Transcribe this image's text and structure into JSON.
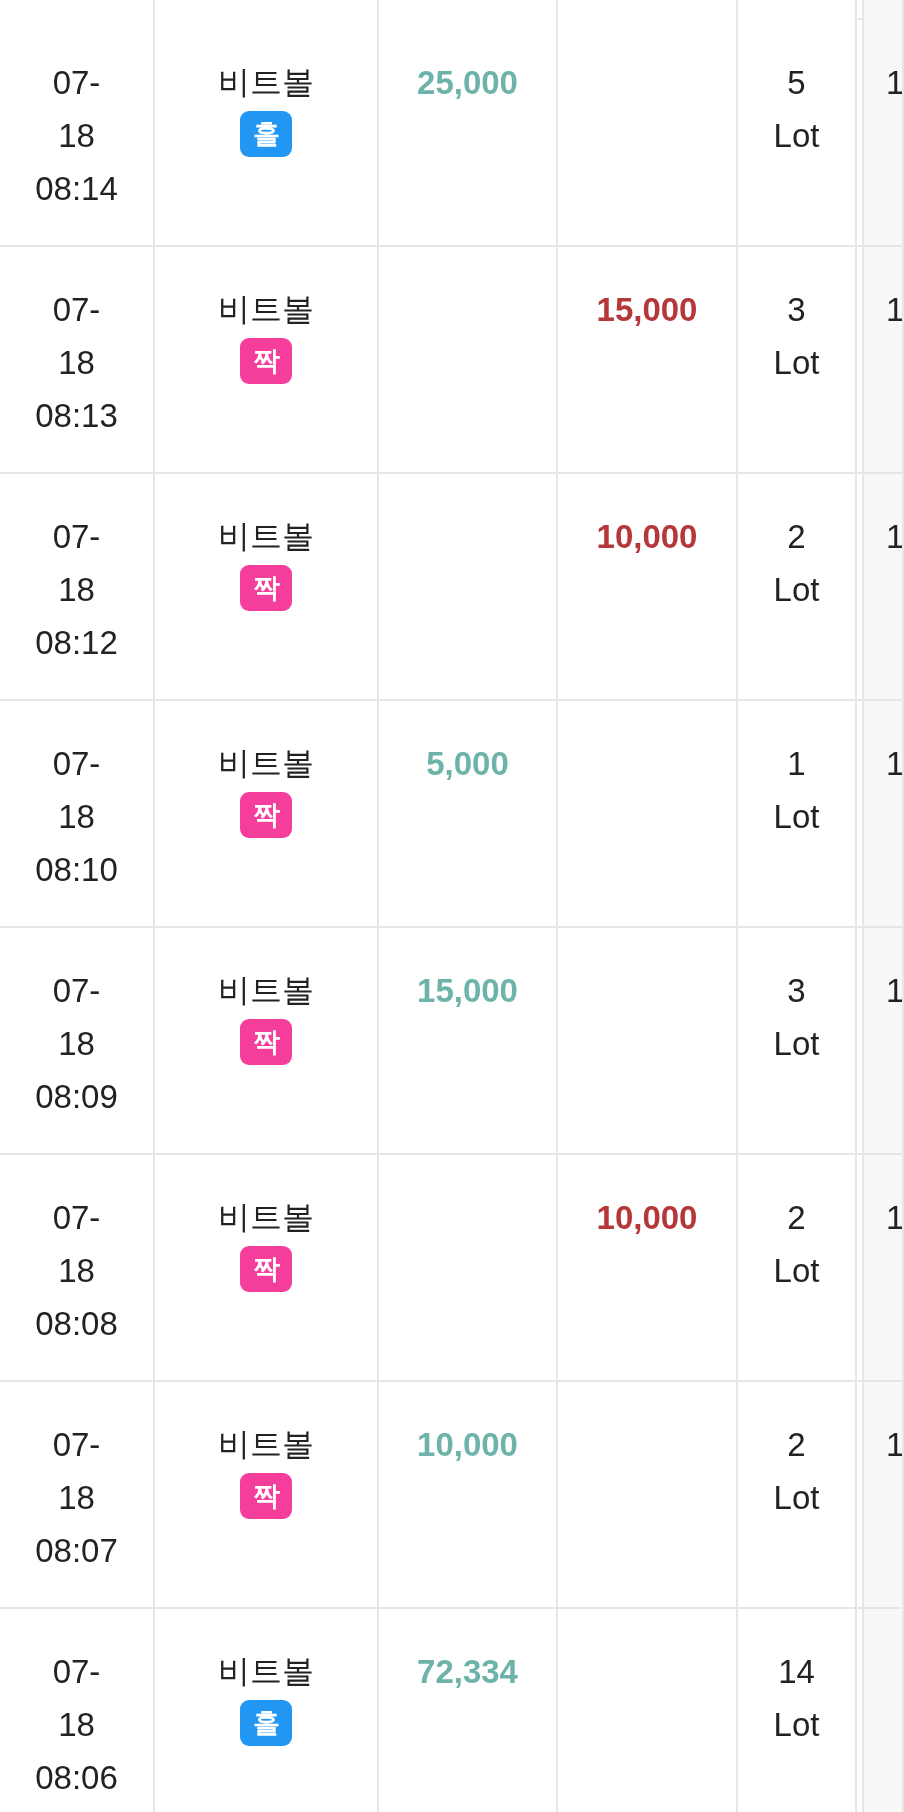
{
  "rows": [
    {
      "datetime": "07-18 08:14",
      "game": "비트볼",
      "badge": {
        "label": "홀",
        "color": "#2196f3"
      },
      "column_3": "25,000",
      "lots": "5 Lot",
      "column_6": "1"
    },
    {
      "datetime": "07-18 08:13",
      "game": "비트볼",
      "badge": {
        "label": "짝",
        "color": "#f53d9b"
      },
      "column_4": "15,000",
      "lots": "3 Lot",
      "column_6": "1"
    },
    {
      "datetime": "07-18 08:12",
      "game": "비트볼",
      "badge": {
        "label": "짝",
        "color": "#f53d9b"
      },
      "column_4": "10,000",
      "lots": "2 Lot",
      "column_6": "1"
    },
    {
      "datetime": "07-18 08:10",
      "game": "비트볼",
      "badge": {
        "label": "짝",
        "color": "#f53d9b"
      },
      "column_3": "5,000",
      "lots": "1 Lot",
      "column_6": "1"
    },
    {
      "datetime": "07-18 08:09",
      "game": "비트볼",
      "badge": {
        "label": "짝",
        "color": "#f53d9b"
      },
      "column_3": "15,000",
      "lots": "3 Lot",
      "column_6": "1"
    },
    {
      "datetime": "07-18 08:08",
      "game": "비트볼",
      "badge": {
        "label": "짝",
        "color": "#f53d9b"
      },
      "column_4": "10,000",
      "lots": "2 Lot",
      "column_6": "1"
    },
    {
      "datetime": "07-18 08:07",
      "game": "비트볼",
      "badge": {
        "label": "짝",
        "color": "#f53d9b"
      },
      "column_3": "10,000",
      "lots": "2 Lot",
      "column_6": "1"
    },
    {
      "datetime": "07-18 08:06",
      "game": "비트볼",
      "badge": {
        "label": "홀",
        "color": "#2196f3"
      },
      "column_3": "72,334",
      "lots": "14 Lot"
    }
  ]
}
